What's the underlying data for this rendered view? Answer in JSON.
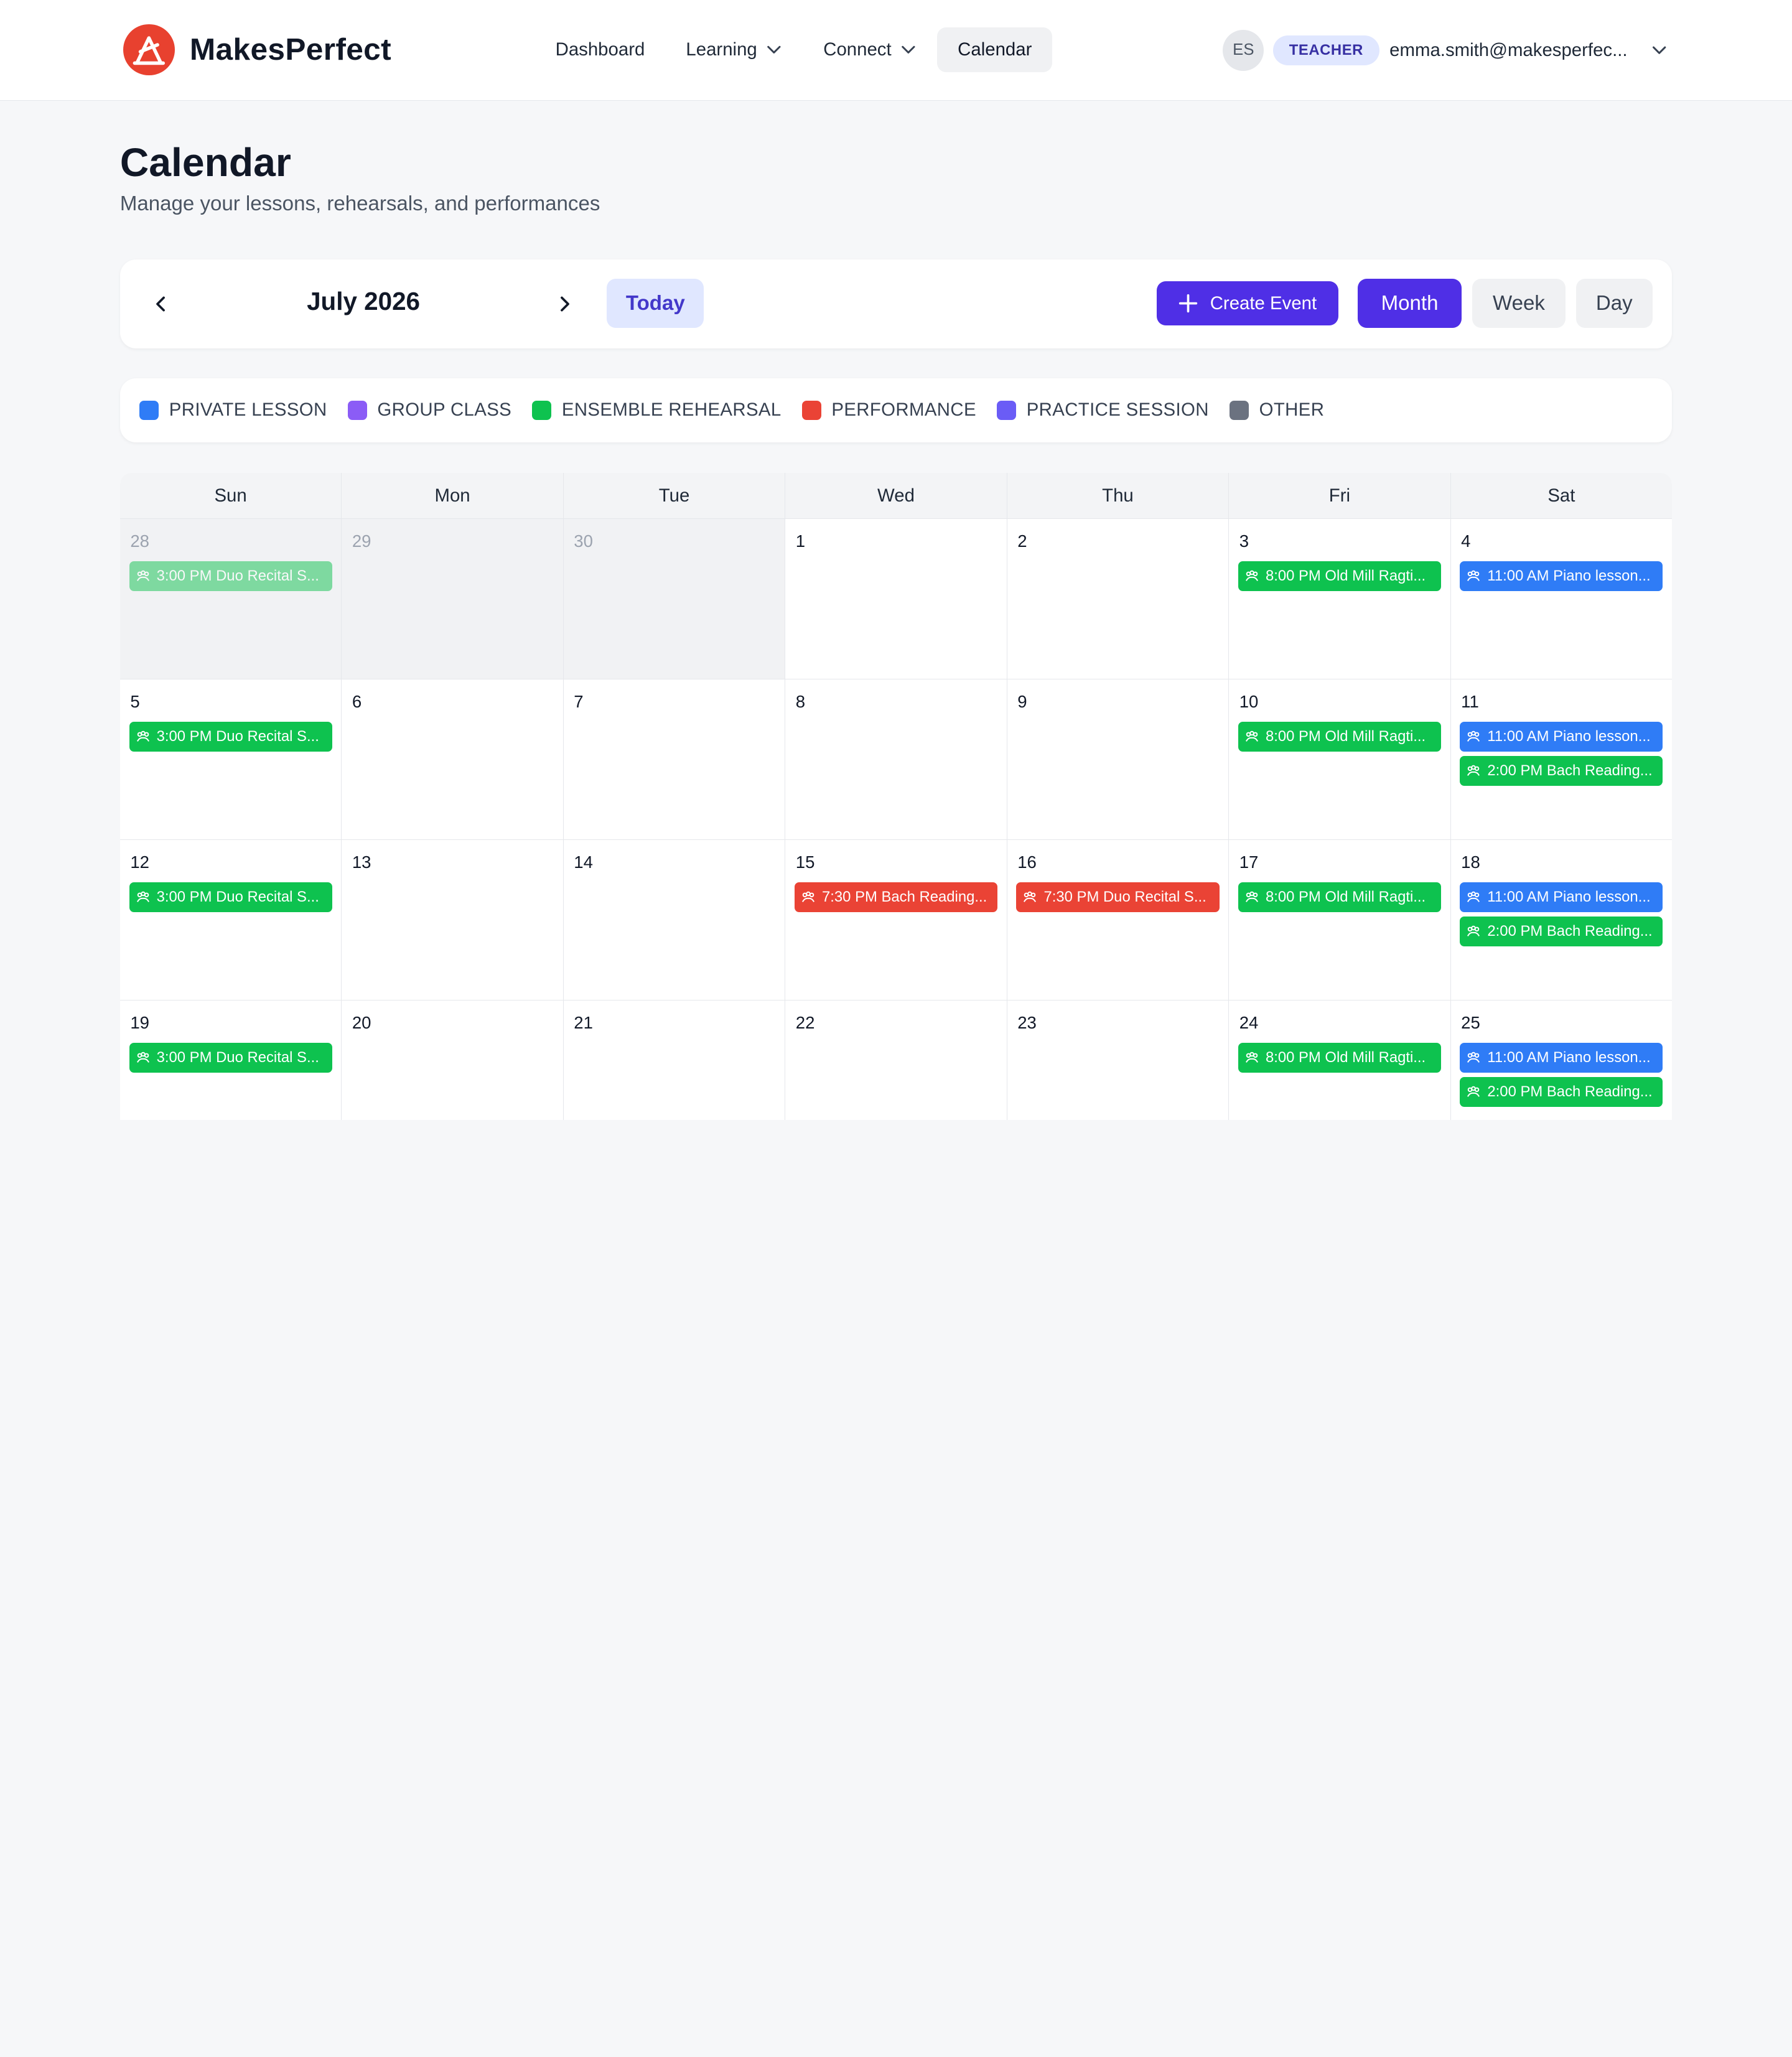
{
  "brand": {
    "name": "MakesPerfect"
  },
  "nav": {
    "dashboard": "Dashboard",
    "learning": "Learning",
    "connect": "Connect",
    "calendar": "Calendar"
  },
  "user": {
    "initials": "ES",
    "role": "TEACHER",
    "email": "emma.smith@makesperfec..."
  },
  "page": {
    "title": "Calendar",
    "subtitle": "Manage your lessons, rehearsals, and performances"
  },
  "toolbar": {
    "month_label": "July 2026",
    "today_label": "Today",
    "create_label": "Create Event",
    "views": {
      "month": "Month",
      "week": "Week",
      "day": "Day"
    }
  },
  "legend": [
    {
      "label": "PRIVATE LESSON",
      "color": "#2f7cf6"
    },
    {
      "label": "GROUP CLASS",
      "color": "#8b5cf6"
    },
    {
      "label": "ENSEMBLE REHEARSAL",
      "color": "#0ec24f"
    },
    {
      "label": "PERFORMANCE",
      "color": "#ea4335"
    },
    {
      "label": "PRACTICE SESSION",
      "color": "#6a5cf6"
    },
    {
      "label": "OTHER",
      "color": "#6b7280"
    }
  ],
  "colors": {
    "private": "#2f7cf6",
    "ensemble": "#0ec24f",
    "performance": "#ea4335",
    "accent": "#4f2fe6"
  },
  "weekdays": [
    "Sun",
    "Mon",
    "Tue",
    "Wed",
    "Thu",
    "Fri",
    "Sat"
  ],
  "weeks": [
    [
      {
        "num": "28",
        "other": true,
        "events": [
          {
            "text": "3:00 PM Duo Recital S...",
            "type": "ensemble"
          }
        ]
      },
      {
        "num": "29",
        "other": true,
        "events": []
      },
      {
        "num": "30",
        "other": true,
        "events": []
      },
      {
        "num": "1",
        "events": []
      },
      {
        "num": "2",
        "events": []
      },
      {
        "num": "3",
        "events": [
          {
            "text": "8:00 PM Old Mill Ragti...",
            "type": "ensemble"
          }
        ]
      },
      {
        "num": "4",
        "events": [
          {
            "text": "11:00 AM Piano lesson...",
            "type": "private"
          }
        ]
      }
    ],
    [
      {
        "num": "5",
        "events": [
          {
            "text": "3:00 PM Duo Recital S...",
            "type": "ensemble"
          }
        ]
      },
      {
        "num": "6",
        "events": []
      },
      {
        "num": "7",
        "events": []
      },
      {
        "num": "8",
        "events": []
      },
      {
        "num": "9",
        "events": []
      },
      {
        "num": "10",
        "events": [
          {
            "text": "8:00 PM Old Mill Ragti...",
            "type": "ensemble"
          }
        ]
      },
      {
        "num": "11",
        "events": [
          {
            "text": "11:00 AM Piano lesson...",
            "type": "private"
          },
          {
            "text": "2:00 PM Bach Reading...",
            "type": "ensemble"
          }
        ]
      }
    ],
    [
      {
        "num": "12",
        "events": [
          {
            "text": "3:00 PM Duo Recital S...",
            "type": "ensemble"
          }
        ]
      },
      {
        "num": "13",
        "events": []
      },
      {
        "num": "14",
        "events": []
      },
      {
        "num": "15",
        "events": [
          {
            "text": "7:30 PM Bach Reading...",
            "type": "performance"
          }
        ]
      },
      {
        "num": "16",
        "events": [
          {
            "text": "7:30 PM Duo Recital S...",
            "type": "performance"
          }
        ]
      },
      {
        "num": "17",
        "events": [
          {
            "text": "8:00 PM Old Mill Ragti...",
            "type": "ensemble"
          }
        ]
      },
      {
        "num": "18",
        "events": [
          {
            "text": "11:00 AM Piano lesson...",
            "type": "private"
          },
          {
            "text": "2:00 PM Bach Reading...",
            "type": "ensemble"
          }
        ]
      }
    ],
    [
      {
        "num": "19",
        "events": [
          {
            "text": "3:00 PM Duo Recital S...",
            "type": "ensemble"
          }
        ]
      },
      {
        "num": "20",
        "events": []
      },
      {
        "num": "21",
        "events": []
      },
      {
        "num": "22",
        "events": []
      },
      {
        "num": "23",
        "events": []
      },
      {
        "num": "24",
        "events": [
          {
            "text": "8:00 PM Old Mill Ragti...",
            "type": "ensemble"
          }
        ]
      },
      {
        "num": "25",
        "events": [
          {
            "text": "11:00 AM Piano lesson...",
            "type": "private"
          },
          {
            "text": "2:00 PM Bach Reading...",
            "type": "ensemble"
          }
        ]
      }
    ]
  ]
}
